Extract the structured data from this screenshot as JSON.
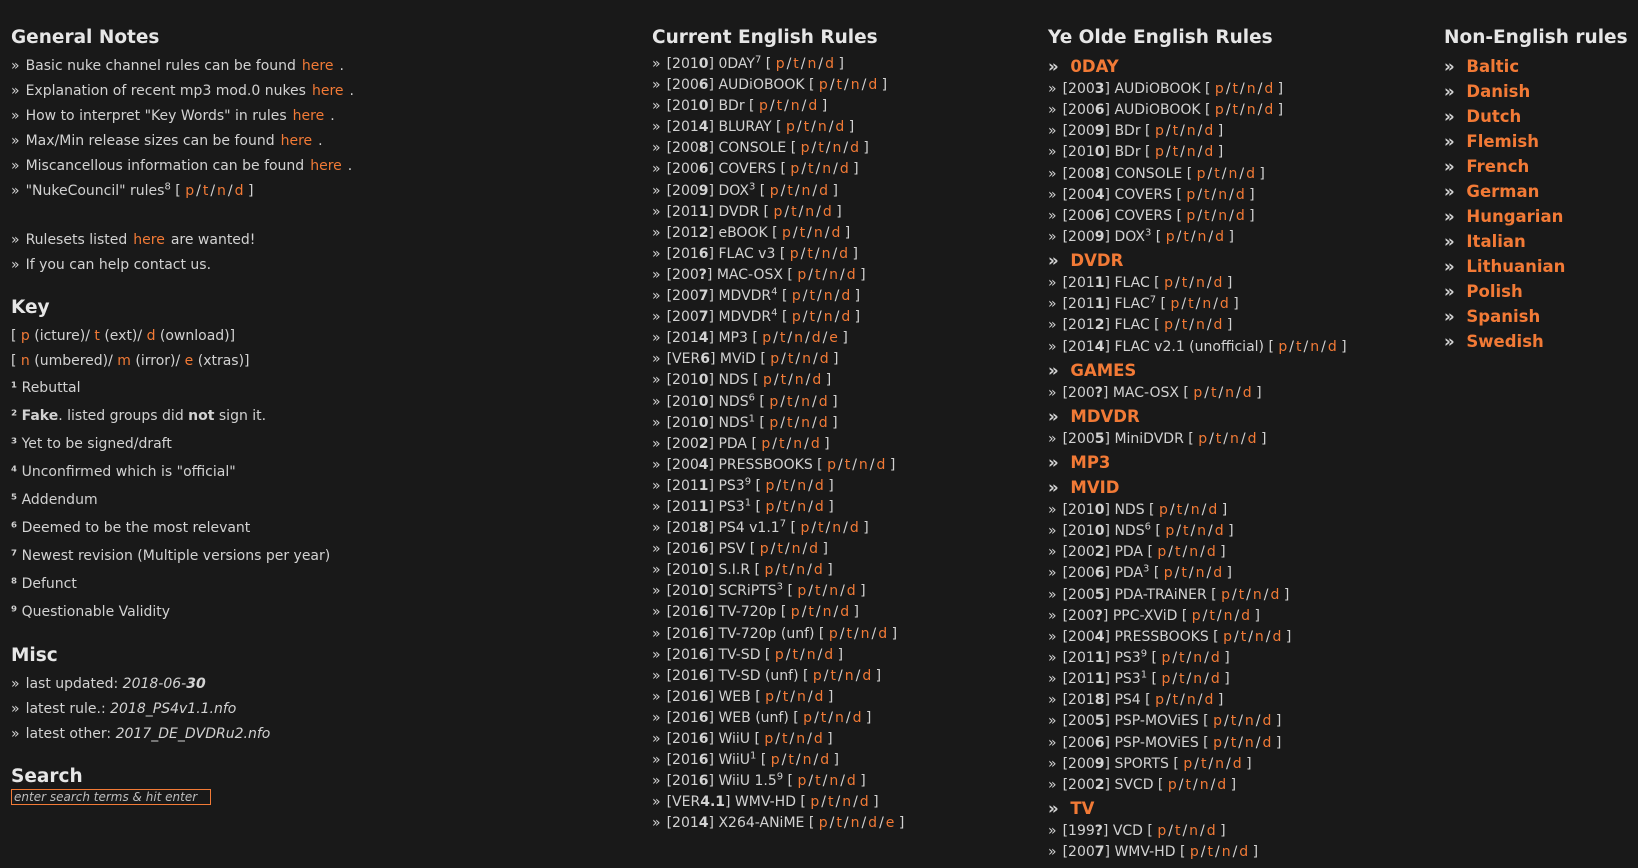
{
  "general": {
    "title": "General Notes",
    "lines": [
      {
        "pre": "Basic nuke channel rules can be found",
        "link": "here",
        "post": "."
      },
      {
        "pre": "Explanation of recent mp3 mod.0 nukes",
        "link": "here",
        "post": "."
      },
      {
        "pre": "How to interpret \"Key Words\" in rules",
        "link": "here",
        "post": "."
      },
      {
        "pre": "Max/Min release sizes can be found",
        "link": "here",
        "post": "."
      },
      {
        "pre": "Miscancellous information can be found",
        "link": "here",
        "post": "."
      }
    ],
    "nukecouncil": {
      "label": "\"NukeCouncil\" rules",
      "sup": "8",
      "links": [
        "p",
        "t",
        "n",
        "d"
      ]
    },
    "wanted": {
      "pre": "Rulesets listed",
      "link": "here",
      "post": "are wanted!"
    },
    "help": "If you can help contact us."
  },
  "key": {
    "title": "Key",
    "line1": [
      {
        "l": "p",
        "t": "(icture)/"
      },
      {
        "l": "t",
        "t": "(ext)/"
      },
      {
        "l": "d",
        "t": "(ownload)]"
      }
    ],
    "line2": [
      {
        "l": "n",
        "t": "(umbered)/"
      },
      {
        "l": "m",
        "t": "(irror)/"
      },
      {
        "l": "e",
        "t": "(xtras)]"
      }
    ],
    "footnotes": [
      {
        "n": "¹",
        "t": "Rebuttal"
      },
      {
        "n": "²",
        "b": "Fake",
        "t": ". listed groups did ",
        "b2": "not",
        "t2": " sign it."
      },
      {
        "n": "³",
        "t": "Yet to be signed/draft"
      },
      {
        "n": "⁴",
        "t": "Unconfirmed which is \"official\""
      },
      {
        "n": "⁵",
        "t": "Addendum"
      },
      {
        "n": "⁶",
        "t": "Deemed to be the most relevant"
      },
      {
        "n": "⁷",
        "t": "Newest revision (Multiple versions per year)"
      },
      {
        "n": "⁸",
        "t": "Defunct"
      },
      {
        "n": "⁹",
        "t": "Questionable Validity"
      }
    ]
  },
  "misc": {
    "title": "Misc",
    "updated_label": "last updated:",
    "updated_pre": "2018-06-",
    "updated_bold": "30",
    "latest_rule_label": "latest rule.:",
    "latest_rule": "2018_PS4v1.1.nfo",
    "latest_other_label": "latest other:",
    "latest_other": "2017_DE_DVDRu2.nfo"
  },
  "search": {
    "title": "Search",
    "placeholder": "enter search terms & hit enter"
  },
  "current": {
    "title": "Current English Rules",
    "rules": [
      {
        "y1": "201",
        "y2": "0",
        "name": "0DAY",
        "sup": "7",
        "links": [
          "p",
          "t",
          "n",
          "d"
        ]
      },
      {
        "y1": "200",
        "y2": "6",
        "name": "AUDiOBOOK",
        "sup": "",
        "links": [
          "p",
          "t",
          "n",
          "d"
        ]
      },
      {
        "y1": "201",
        "y2": "0",
        "name": "BDr",
        "sup": "",
        "links": [
          "p",
          "t",
          "n",
          "d"
        ]
      },
      {
        "y1": "201",
        "y2": "4",
        "name": "BLURAY",
        "sup": "",
        "links": [
          "p",
          "t",
          "n",
          "d"
        ]
      },
      {
        "y1": "200",
        "y2": "8",
        "name": "CONSOLE",
        "sup": "",
        "links": [
          "p",
          "t",
          "n",
          "d"
        ]
      },
      {
        "y1": "200",
        "y2": "6",
        "name": "COVERS",
        "sup": "",
        "links": [
          "p",
          "t",
          "n",
          "d"
        ]
      },
      {
        "y1": "200",
        "y2": "9",
        "name": "DOX",
        "sup": "3",
        "links": [
          "p",
          "t",
          "n",
          "d"
        ]
      },
      {
        "y1": "201",
        "y2": "1",
        "name": "DVDR",
        "sup": "",
        "links": [
          "p",
          "t",
          "n",
          "d"
        ]
      },
      {
        "y1": "201",
        "y2": "2",
        "name": "eBOOK",
        "sup": "",
        "links": [
          "p",
          "t",
          "n",
          "d"
        ]
      },
      {
        "y1": "201",
        "y2": "6",
        "name": "FLAC v3",
        "sup": "",
        "links": [
          "p",
          "t",
          "n",
          "d"
        ]
      },
      {
        "y1": "200",
        "y2": "?",
        "name": "MAC-OSX",
        "sup": "",
        "links": [
          "p",
          "t",
          "n",
          "d"
        ]
      },
      {
        "y1": "200",
        "y2": "7",
        "name": "MDVDR",
        "sup": "4",
        "links": [
          "p",
          "t",
          "n",
          "d"
        ]
      },
      {
        "y1": "200",
        "y2": "7",
        "name": "MDVDR",
        "sup": "4",
        "links": [
          "p",
          "t",
          "n",
          "d"
        ]
      },
      {
        "y1": "201",
        "y2": "4",
        "name": "MP3",
        "sup": "",
        "links": [
          "p",
          "t",
          "n",
          "d",
          "e"
        ]
      },
      {
        "y1": "VER",
        "y2": "6",
        "name": "MViD",
        "sup": "",
        "links": [
          "p",
          "t",
          "n",
          "d"
        ]
      },
      {
        "y1": "201",
        "y2": "0",
        "name": "NDS",
        "sup": "",
        "links": [
          "p",
          "t",
          "n",
          "d"
        ]
      },
      {
        "y1": "201",
        "y2": "0",
        "name": "NDS",
        "sup": "6",
        "links": [
          "p",
          "t",
          "n",
          "d"
        ]
      },
      {
        "y1": "201",
        "y2": "0",
        "name": "NDS",
        "sup": "1",
        "links": [
          "p",
          "t",
          "n",
          "d"
        ]
      },
      {
        "y1": "200",
        "y2": "2",
        "name": "PDA",
        "sup": "",
        "links": [
          "p",
          "t",
          "n",
          "d"
        ]
      },
      {
        "y1": "200",
        "y2": "4",
        "name": "PRESSBOOKS",
        "sup": "",
        "links": [
          "p",
          "t",
          "n",
          "d"
        ]
      },
      {
        "y1": "201",
        "y2": "1",
        "name": "PS3",
        "sup": "9",
        "links": [
          "p",
          "t",
          "n",
          "d"
        ]
      },
      {
        "y1": "201",
        "y2": "1",
        "name": "PS3",
        "sup": "1",
        "links": [
          "p",
          "t",
          "n",
          "d"
        ]
      },
      {
        "y1": "201",
        "y2": "8",
        "name": "PS4 v1.1",
        "sup": "7",
        "links": [
          "p",
          "t",
          "n",
          "d"
        ]
      },
      {
        "y1": "201",
        "y2": "6",
        "name": "PSV",
        "sup": "",
        "links": [
          "p",
          "t",
          "n",
          "d"
        ]
      },
      {
        "y1": "201",
        "y2": "0",
        "name": "S.I.R",
        "sup": "",
        "links": [
          "p",
          "t",
          "n",
          "d"
        ]
      },
      {
        "y1": "201",
        "y2": "0",
        "name": "SCRiPTS",
        "sup": "3",
        "links": [
          "p",
          "t",
          "n",
          "d"
        ]
      },
      {
        "y1": "201",
        "y2": "6",
        "name": "TV-720p",
        "sup": "",
        "links": [
          "p",
          "t",
          "n",
          "d"
        ]
      },
      {
        "y1": "201",
        "y2": "6",
        "name": "TV-720p (unf)",
        "sup": "",
        "links": [
          "p",
          "t",
          "n",
          "d"
        ]
      },
      {
        "y1": "201",
        "y2": "6",
        "name": "TV-SD",
        "sup": "",
        "links": [
          "p",
          "t",
          "n",
          "d"
        ]
      },
      {
        "y1": "201",
        "y2": "6",
        "name": "TV-SD (unf)",
        "sup": "",
        "links": [
          "p",
          "t",
          "n",
          "d"
        ]
      },
      {
        "y1": "201",
        "y2": "6",
        "name": "WEB",
        "sup": "",
        "links": [
          "p",
          "t",
          "n",
          "d"
        ]
      },
      {
        "y1": "201",
        "y2": "6",
        "name": "WEB (unf)",
        "sup": "",
        "links": [
          "p",
          "t",
          "n",
          "d"
        ]
      },
      {
        "y1": "201",
        "y2": "6",
        "name": "WiiU",
        "sup": "",
        "links": [
          "p",
          "t",
          "n",
          "d"
        ]
      },
      {
        "y1": "201",
        "y2": "6",
        "name": "WiiU",
        "sup": "1",
        "links": [
          "p",
          "t",
          "n",
          "d"
        ]
      },
      {
        "y1": "201",
        "y2": "6",
        "name": "WiiU 1.5",
        "sup": "9",
        "links": [
          "p",
          "t",
          "n",
          "d"
        ]
      },
      {
        "y1": "VER",
        "y2": "4.1",
        "name": "WMV-HD",
        "sup": "",
        "links": [
          "p",
          "t",
          "n",
          "d"
        ]
      },
      {
        "y1": "201",
        "y2": "4",
        "name": "X264-ANiME",
        "sup": "",
        "links": [
          "p",
          "t",
          "n",
          "d",
          "e"
        ]
      }
    ]
  },
  "olde": {
    "title": "Ye Olde English Rules",
    "items": [
      {
        "cat": "0DAY"
      },
      {
        "y1": "200",
        "y2": "3",
        "name": "AUDiOBOOK",
        "sup": "",
        "links": [
          "p",
          "t",
          "n",
          "d"
        ]
      },
      {
        "y1": "200",
        "y2": "6",
        "name": "AUDiOBOOK",
        "sup": "",
        "links": [
          "p",
          "t",
          "n",
          "d"
        ]
      },
      {
        "y1": "200",
        "y2": "9",
        "name": "BDr",
        "sup": "",
        "links": [
          "p",
          "t",
          "n",
          "d"
        ]
      },
      {
        "y1": "201",
        "y2": "0",
        "name": "BDr",
        "sup": "",
        "links": [
          "p",
          "t",
          "n",
          "d"
        ]
      },
      {
        "y1": "200",
        "y2": "8",
        "name": "CONSOLE",
        "sup": "",
        "links": [
          "p",
          "t",
          "n",
          "d"
        ]
      },
      {
        "y1": "200",
        "y2": "4",
        "name": "COVERS",
        "sup": "",
        "links": [
          "p",
          "t",
          "n",
          "d"
        ]
      },
      {
        "y1": "200",
        "y2": "6",
        "name": "COVERS",
        "sup": "",
        "links": [
          "p",
          "t",
          "n",
          "d"
        ]
      },
      {
        "y1": "200",
        "y2": "9",
        "name": "DOX",
        "sup": "3",
        "links": [
          "p",
          "t",
          "n",
          "d"
        ]
      },
      {
        "cat": "DVDR"
      },
      {
        "y1": "201",
        "y2": "1",
        "name": "FLAC",
        "sup": "",
        "links": [
          "p",
          "t",
          "n",
          "d"
        ]
      },
      {
        "y1": "201",
        "y2": "1",
        "name": "FLAC",
        "sup": "7",
        "links": [
          "p",
          "t",
          "n",
          "d"
        ]
      },
      {
        "y1": "201",
        "y2": "2",
        "name": "FLAC",
        "sup": "",
        "links": [
          "p",
          "t",
          "n",
          "d"
        ]
      },
      {
        "y1": "201",
        "y2": "4",
        "name": "FLAC v2.1 (unofficial)",
        "sup": "",
        "links": [
          "p",
          "t",
          "n",
          "d"
        ]
      },
      {
        "cat": "GAMES"
      },
      {
        "y1": "200",
        "y2": "?",
        "name": "MAC-OSX",
        "sup": "",
        "links": [
          "p",
          "t",
          "n",
          "d"
        ]
      },
      {
        "cat": "MDVDR"
      },
      {
        "y1": "200",
        "y2": "5",
        "name": "MiniDVDR",
        "sup": "",
        "links": [
          "p",
          "t",
          "n",
          "d"
        ]
      },
      {
        "cat": "MP3"
      },
      {
        "cat": "MVID"
      },
      {
        "y1": "201",
        "y2": "0",
        "name": "NDS",
        "sup": "",
        "links": [
          "p",
          "t",
          "n",
          "d"
        ]
      },
      {
        "y1": "201",
        "y2": "0",
        "name": "NDS",
        "sup": "6",
        "links": [
          "p",
          "t",
          "n",
          "d"
        ]
      },
      {
        "y1": "200",
        "y2": "2",
        "name": "PDA",
        "sup": "",
        "links": [
          "p",
          "t",
          "n",
          "d"
        ]
      },
      {
        "y1": "200",
        "y2": "6",
        "name": "PDA",
        "sup": "3",
        "links": [
          "p",
          "t",
          "n",
          "d"
        ]
      },
      {
        "y1": "200",
        "y2": "5",
        "name": "PDA-TRAiNER",
        "sup": "",
        "links": [
          "p",
          "t",
          "n",
          "d"
        ]
      },
      {
        "y1": "200",
        "y2": "?",
        "name": "PPC-XViD",
        "sup": "",
        "links": [
          "p",
          "t",
          "n",
          "d"
        ]
      },
      {
        "y1": "200",
        "y2": "4",
        "name": "PRESSBOOKS",
        "sup": "",
        "links": [
          "p",
          "t",
          "n",
          "d"
        ]
      },
      {
        "y1": "201",
        "y2": "1",
        "name": "PS3",
        "sup": "9",
        "links": [
          "p",
          "t",
          "n",
          "d"
        ]
      },
      {
        "y1": "201",
        "y2": "1",
        "name": "PS3",
        "sup": "1",
        "links": [
          "p",
          "t",
          "n",
          "d"
        ]
      },
      {
        "y1": "201",
        "y2": "8",
        "name": "PS4",
        "sup": "",
        "links": [
          "p",
          "t",
          "n",
          "d"
        ]
      },
      {
        "y1": "200",
        "y2": "5",
        "name": "PSP-MOViES",
        "sup": "",
        "links": [
          "p",
          "t",
          "n",
          "d"
        ]
      },
      {
        "y1": "200",
        "y2": "6",
        "name": "PSP-MOViES",
        "sup": "",
        "links": [
          "p",
          "t",
          "n",
          "d"
        ]
      },
      {
        "y1": "200",
        "y2": "9",
        "name": "SPORTS",
        "sup": "",
        "links": [
          "p",
          "t",
          "n",
          "d"
        ]
      },
      {
        "y1": "200",
        "y2": "2",
        "name": "SVCD",
        "sup": "",
        "links": [
          "p",
          "t",
          "n",
          "d"
        ]
      },
      {
        "cat": "TV"
      },
      {
        "y1": "199",
        "y2": "?",
        "name": "VCD",
        "sup": "",
        "links": [
          "p",
          "t",
          "n",
          "d"
        ]
      },
      {
        "y1": "200",
        "y2": "7",
        "name": "WMV-HD",
        "sup": "",
        "links": [
          "p",
          "t",
          "n",
          "d"
        ]
      }
    ]
  },
  "nonenglish": {
    "title": "Non-English rules",
    "items": [
      "Baltic",
      "Danish",
      "Dutch",
      "Flemish",
      "French",
      "German",
      "Hungarian",
      "Italian",
      "Lithuanian",
      "Polish",
      "Spanish",
      "Swedish"
    ]
  },
  "glyphs": {
    "arrow": "»",
    "open": "[",
    "close": "]",
    "slash": "/"
  },
  "colors": {
    "background": "#191919",
    "text": "#d2d2d2",
    "link": "#f27a36",
    "heading": "#e6e6e6"
  }
}
